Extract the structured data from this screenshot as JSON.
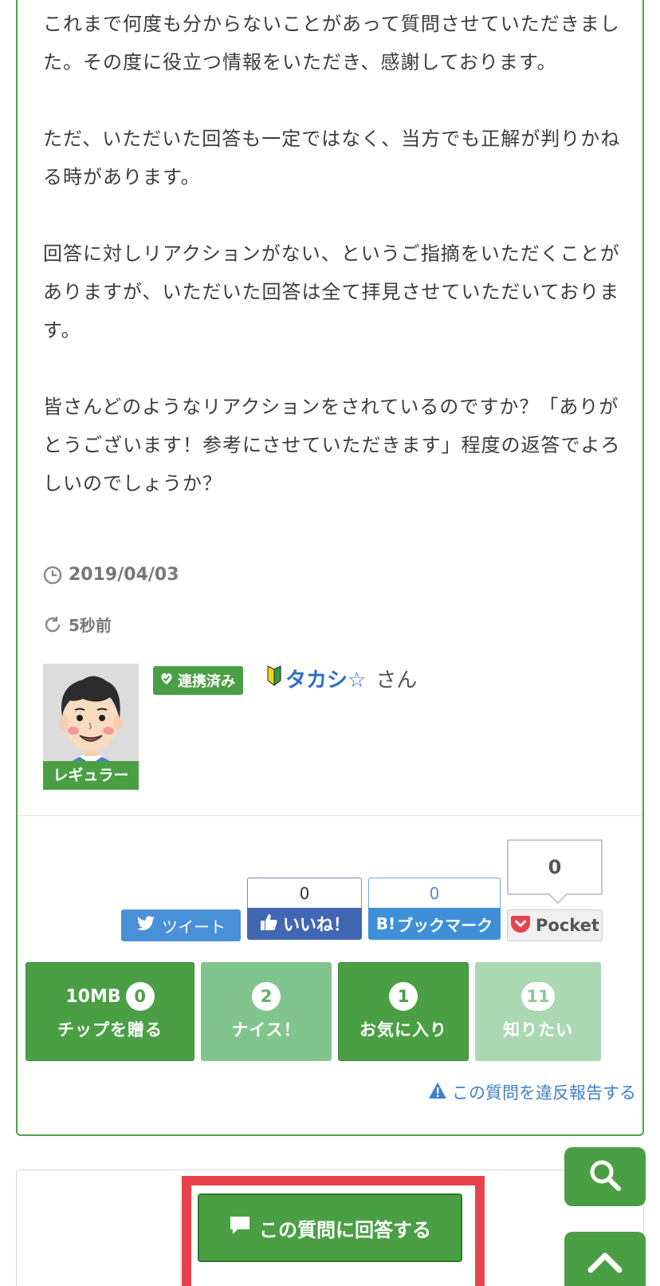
{
  "question": {
    "paragraphs": [
      "これまで何度も分からないことがあって質問させていただきました。その度に役立つ情報をいただき、感謝しております。",
      "ただ、いただいた回答も一定ではなく、当方でも正解が判りかねる時があります。",
      "回答に対しリアクションがない、というご指摘をいただくことがありますが、いただいた回答は全て拝見させていただいております。",
      "皆さんどのようなリアクションをされているのですか？「ありがとうございます！参考にさせていただきます」程度の返答でよろしいのでしょうか？"
    ],
    "date": "2019/04/03",
    "updated": "5秒前"
  },
  "user": {
    "rank_label": "レギュラー",
    "linked_badge": "連携済み",
    "name": "タカシ☆",
    "honorific": "さん"
  },
  "social": {
    "tweet_label": "ツイート",
    "like_count": "0",
    "like_label": "いいね！",
    "hatena_count": "0",
    "hatena_label": "ブックマーク",
    "hatena_b": "B!",
    "pocket_count": "0",
    "pocket_label": "Pocket"
  },
  "actions": {
    "tip": {
      "prefix": "10MB",
      "count": "0",
      "label": "チップを贈る"
    },
    "nice": {
      "count": "2",
      "label": "ナイス！"
    },
    "favorite": {
      "count": "1",
      "label": "お気に入り"
    },
    "want_to_know": {
      "count": "11",
      "label": "知りたい"
    }
  },
  "report_label": "この質問を違反報告する",
  "answer_button_label": "この質問に回答する",
  "colors": {
    "brand_green": "#4a9f44",
    "highlight_red": "#e8434b",
    "link_blue": "#3f80c8"
  },
  "icons": [
    "clock-icon",
    "refresh-icon",
    "heart-check-icon",
    "beginner-mark-icon",
    "twitter-bird-icon",
    "thumbs-up-icon",
    "pocket-icon",
    "warning-icon",
    "speech-bubble-icon",
    "search-icon",
    "chevron-up-icon"
  ]
}
